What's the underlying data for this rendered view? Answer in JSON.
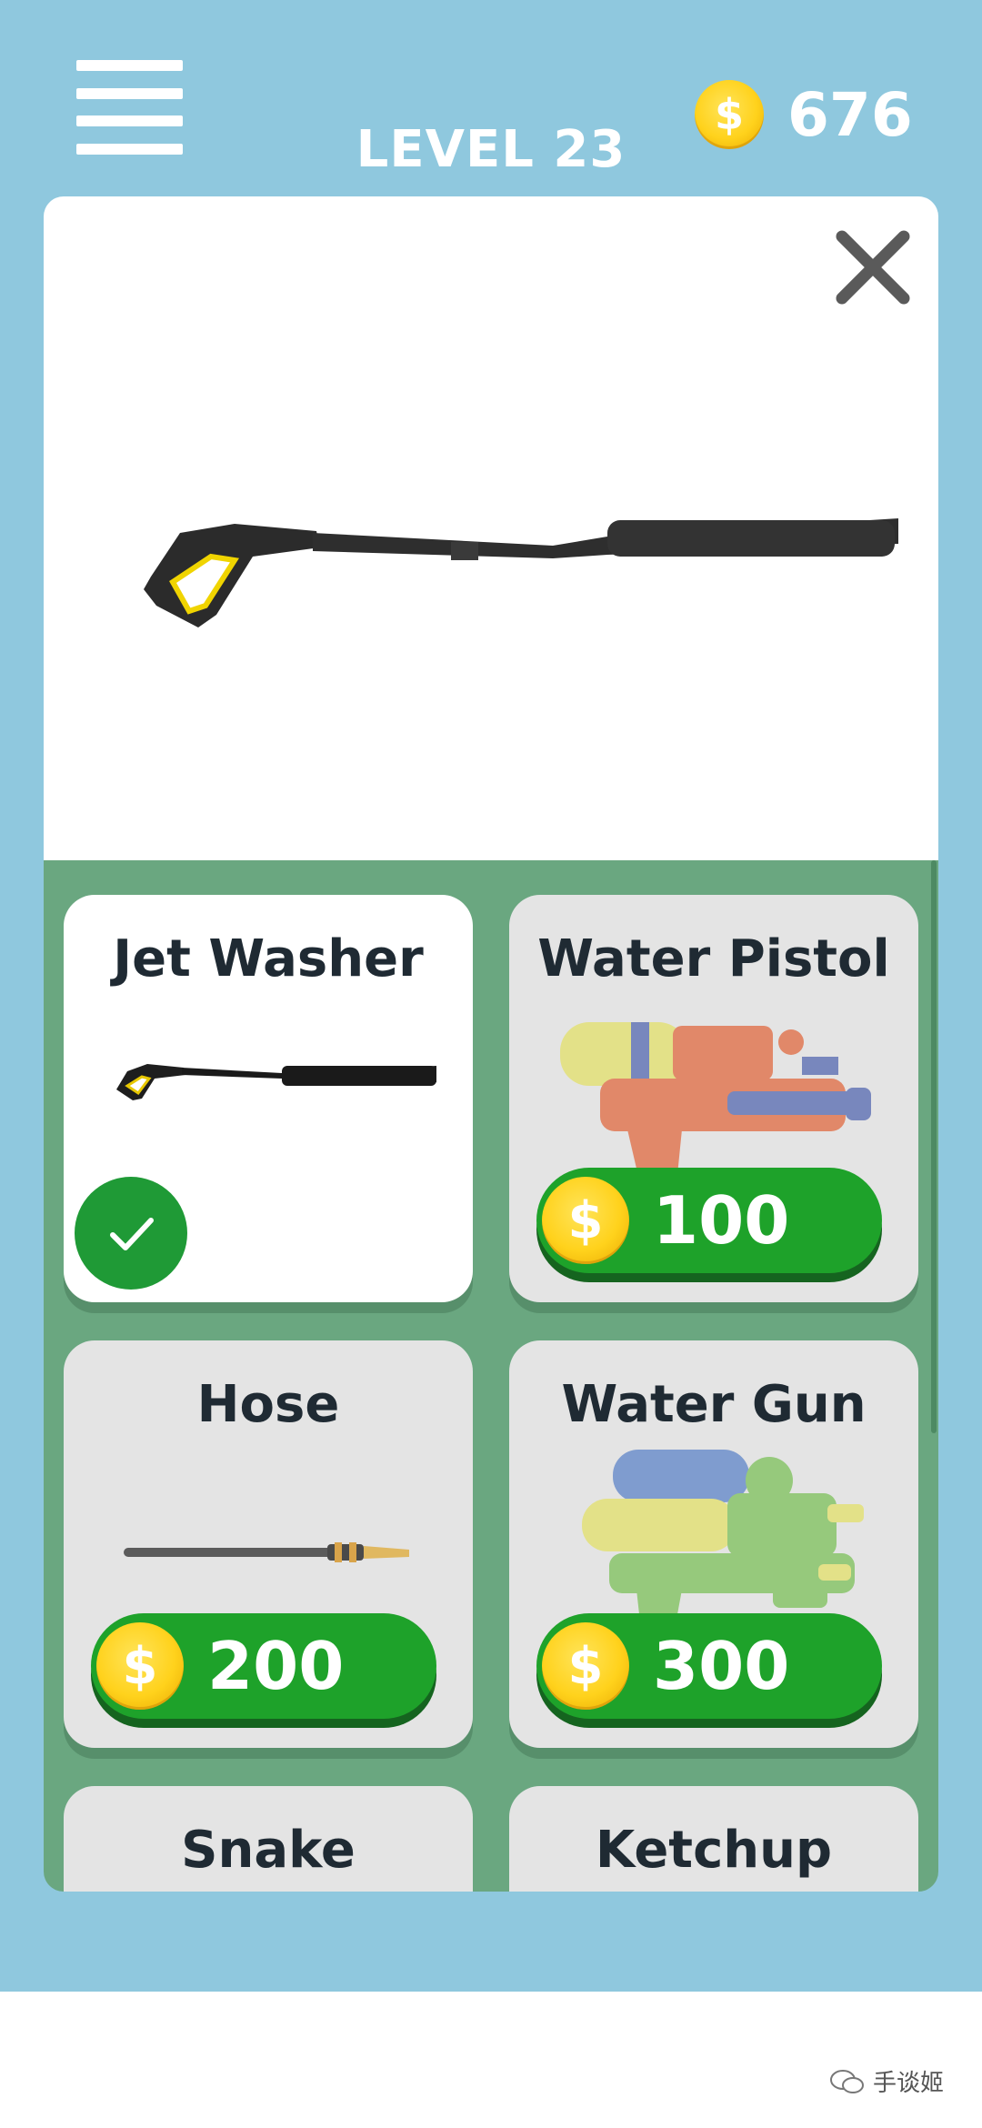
{
  "header": {
    "level": "LEVEL 23",
    "coins": "676",
    "coin_symbol": "$"
  },
  "preview": {
    "item": "Jet Washer",
    "icon": "close-icon"
  },
  "shop": {
    "items": [
      {
        "name": "Jet Washer",
        "owned": true,
        "price": ""
      },
      {
        "name": "Water Pistol",
        "owned": false,
        "price": "100"
      },
      {
        "name": "Hose",
        "owned": false,
        "price": "200"
      },
      {
        "name": "Water Gun",
        "owned": false,
        "price": "300"
      },
      {
        "name": "Snake",
        "owned": false,
        "price": ""
      },
      {
        "name": "Ketchup",
        "owned": false,
        "price": ""
      }
    ]
  },
  "colors": {
    "background": "#8fc8de",
    "shop_panel": "#6aa780",
    "price_button": "#1ea22a",
    "coin": "#ffd21c",
    "owned_badge": "#1f9a36"
  },
  "watermark": "手谈姬"
}
